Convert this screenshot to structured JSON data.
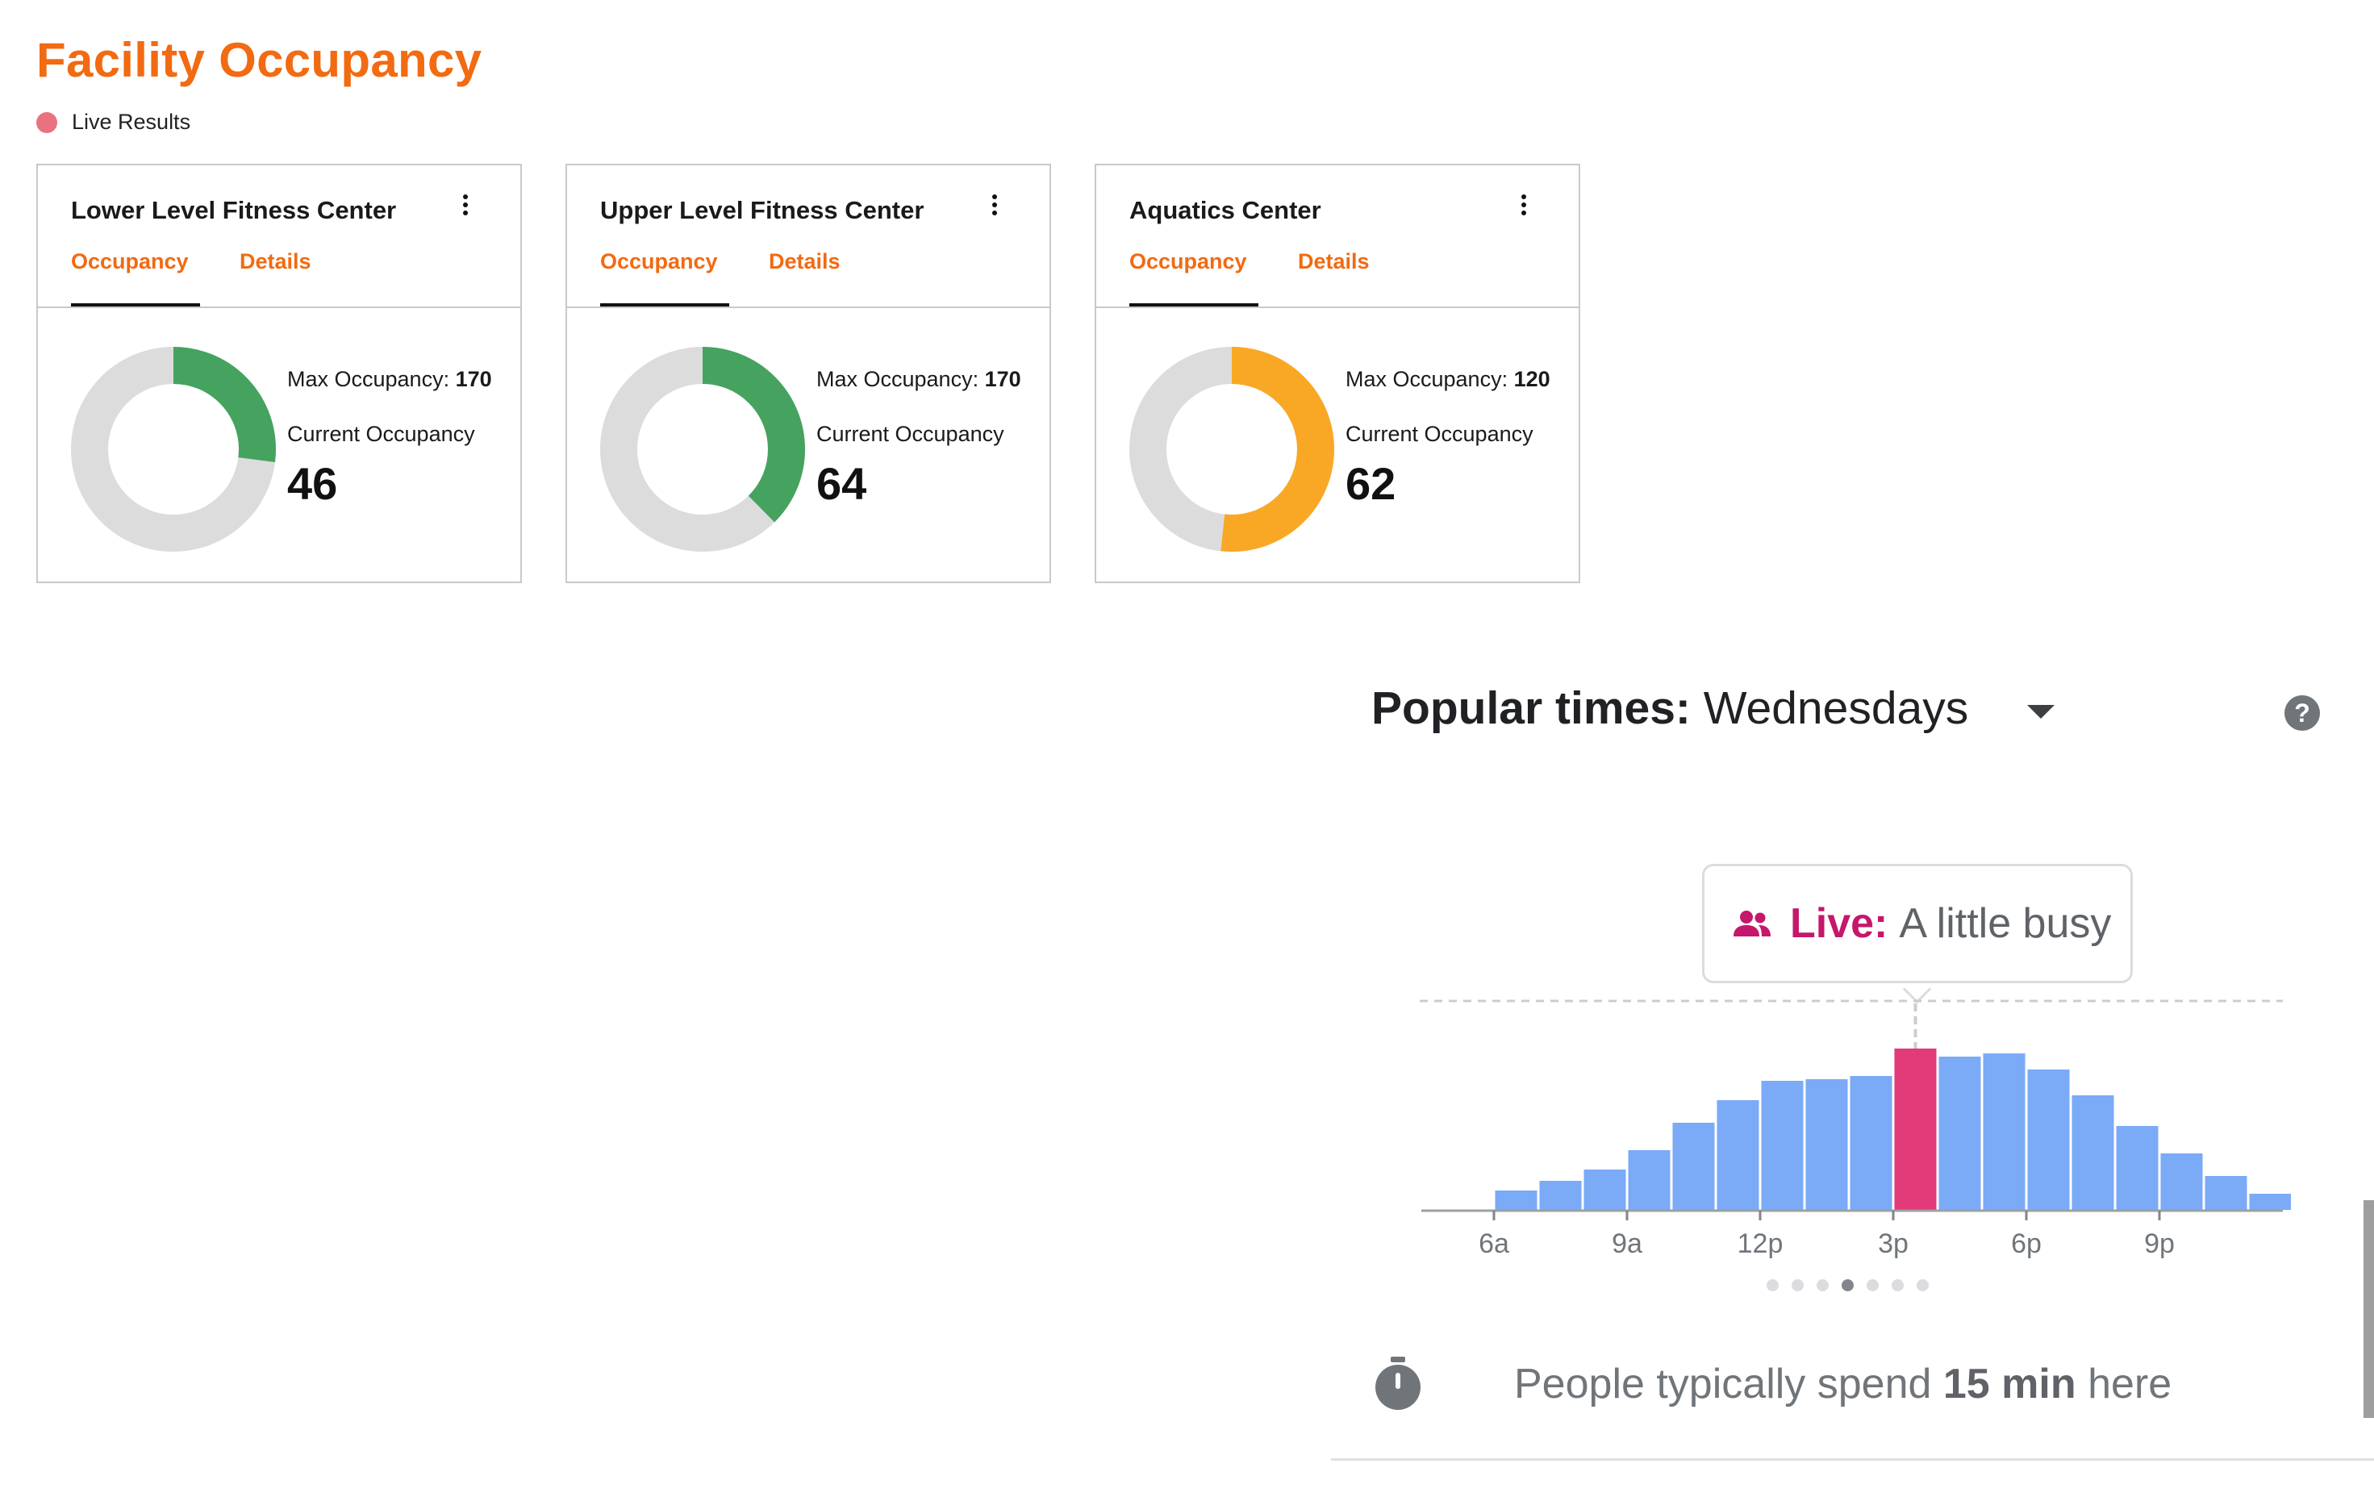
{
  "header": {
    "title": "Facility Occupancy",
    "live_label": "Live Results",
    "live_dot_color": "#e8727f"
  },
  "cards": [
    {
      "title": "Lower Level Fitness Center",
      "tabs": [
        "Occupancy",
        "Details"
      ],
      "active_tab": "Occupancy",
      "max_label": "Max Occupancy:",
      "max_value": "170",
      "current_label": "Current Occupancy",
      "current_value": "46",
      "fill_color": "#45a35f",
      "occupancy_fraction": 0.27
    },
    {
      "title": "Upper Level Fitness Center",
      "tabs": [
        "Occupancy",
        "Details"
      ],
      "active_tab": "Occupancy",
      "max_label": "Max Occupancy:",
      "max_value": "170",
      "current_label": "Current Occupancy",
      "current_value": "64",
      "fill_color": "#45a35f",
      "occupancy_fraction": 0.376
    },
    {
      "title": "Aquatics Center",
      "tabs": [
        "Occupancy",
        "Details"
      ],
      "active_tab": "Occupancy",
      "max_label": "Max Occupancy:",
      "max_value": "120",
      "current_label": "Current Occupancy",
      "current_value": "62",
      "fill_color": "#f9a825",
      "occupancy_fraction": 0.517
    }
  ],
  "popular_times": {
    "title_bold": "Popular times:",
    "day": "Wednesdays",
    "live_label": "Live:",
    "live_status": "A little busy",
    "live_color": "#c5176b",
    "bar_color": "#7baaf7",
    "live_bar_color": "#e23a78",
    "spend_prefix": "People typically spend",
    "spend_duration": "15 min",
    "spend_suffix": "here",
    "pager_count": 7,
    "pager_active": 3
  },
  "chart_data": {
    "type": "bar",
    "title": "",
    "x_tick_labels": [
      "6a",
      "9a",
      "12p",
      "3p",
      "6p",
      "9p"
    ],
    "hours": [
      "6a",
      "7a",
      "8a",
      "9a",
      "10a",
      "11a",
      "12p",
      "1p",
      "2p",
      "3p",
      "4p",
      "5p",
      "6p",
      "7p",
      "8p",
      "9p",
      "10p",
      "11p"
    ],
    "values": [
      12,
      18,
      25,
      37,
      54,
      68,
      80,
      81,
      83,
      100,
      95,
      97,
      87,
      71,
      52,
      35,
      21,
      10
    ],
    "live_index": 9,
    "ylim": [
      0,
      100
    ],
    "grid": false
  }
}
